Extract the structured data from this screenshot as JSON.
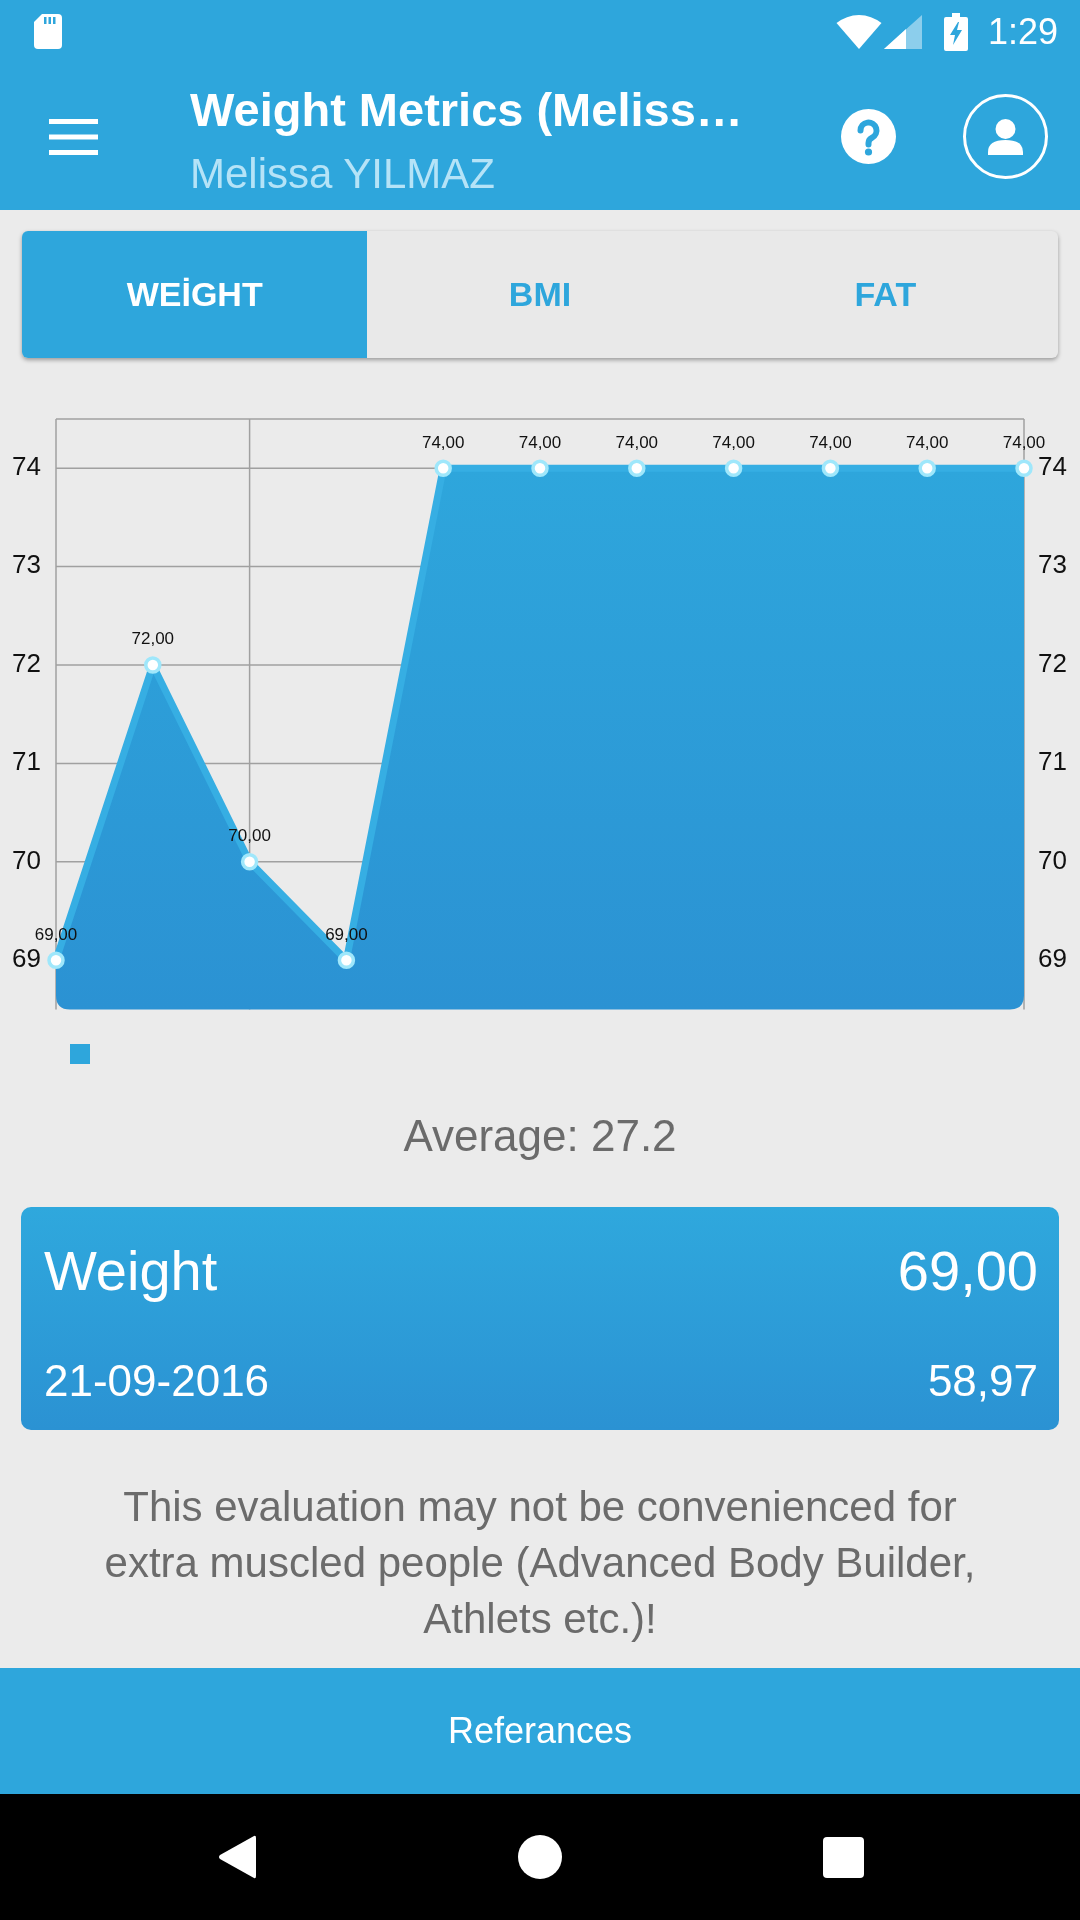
{
  "status_bar": {
    "time": "1:29"
  },
  "app_bar": {
    "title": "Weight Metrics (Meliss…",
    "subtitle": "Melissa YILMAZ"
  },
  "tabs": [
    {
      "label": "WEİGHT",
      "selected": true
    },
    {
      "label": "BMI",
      "selected": false
    },
    {
      "label": "FAT",
      "selected": false
    }
  ],
  "chart": {
    "chart_data": {
      "type": "area",
      "grid": true,
      "ylim": [
        68.5,
        74.5
      ],
      "yticks": [
        69,
        70,
        71,
        72,
        73,
        74
      ],
      "series": [
        {
          "color": "#2ea6dc",
          "values": [
            69,
            72,
            70,
            69,
            74,
            74,
            74,
            74,
            74,
            74,
            74
          ]
        }
      ],
      "value_labels": [
        "69,00",
        "72,00",
        "70,00",
        "69,00",
        "74,00",
        "74,00",
        "74,00",
        "74,00",
        "74,00",
        "74,00",
        "74,00"
      ]
    },
    "right_axis_labels": [
      "74",
      "73",
      "72",
      "71",
      "70",
      "69"
    ]
  },
  "average": "Average: 27.2",
  "summary_card": {
    "label": "Weight",
    "value": "69,00",
    "date": "21-09-2016",
    "secondary_value": "58,97"
  },
  "disclaimer": "This evaluation may not be convenienced for extra muscled people (Advanced Body Builder, Athlets etc.)!",
  "references_button": "Referances"
}
